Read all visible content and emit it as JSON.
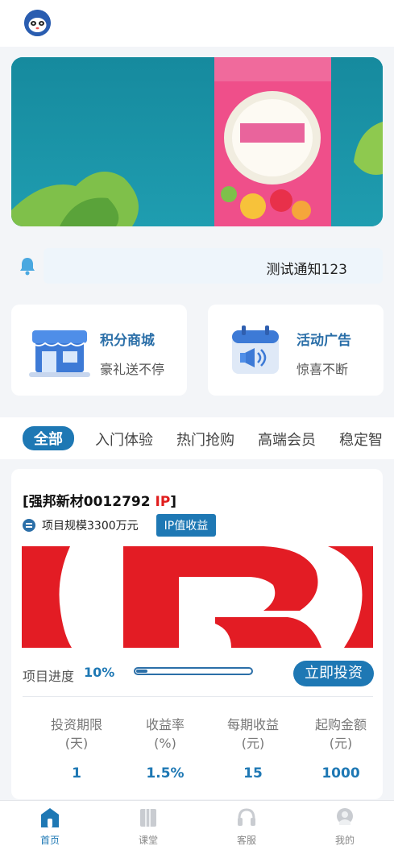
{
  "notice": {
    "text": "测试通知123"
  },
  "shortcuts": [
    {
      "title": "积分商城",
      "subtitle": "豪礼送不停"
    },
    {
      "title": "活动广告",
      "subtitle": "惊喜不断"
    }
  ],
  "tabs": [
    "全部",
    "入门体验",
    "热门抢购",
    "高端会员",
    "稳定智"
  ],
  "product": {
    "name": "[强邦新材0012792 ",
    "name_tag": "IP",
    "name_end": "]",
    "scale_text": "项目规模3300万元",
    "badge": "IP值收益",
    "progress_label": "项目进度",
    "progress_value": "10%",
    "progress_fraction": 0.1,
    "invest_button": "立即投资",
    "stats": [
      {
        "label1": "投资期限",
        "label2": "(天)",
        "value": "1"
      },
      {
        "label1": "收益率",
        "label2": "(%)",
        "value": "1.5%"
      },
      {
        "label1": "每期收益",
        "label2": "(元)",
        "value": "15"
      },
      {
        "label1": "起购金额",
        "label2": "(元)",
        "value": "1000"
      }
    ]
  },
  "nav": [
    {
      "label": "首页",
      "icon": "home-icon",
      "active": true
    },
    {
      "label": "课堂",
      "icon": "book-icon",
      "active": false
    },
    {
      "label": "客服",
      "icon": "headset-icon",
      "active": false
    },
    {
      "label": "我的",
      "icon": "user-icon",
      "active": false
    }
  ],
  "colors": {
    "accent": "#1e78b4",
    "tag_red": "#e01d1d",
    "brand_red": "#e31c24"
  }
}
